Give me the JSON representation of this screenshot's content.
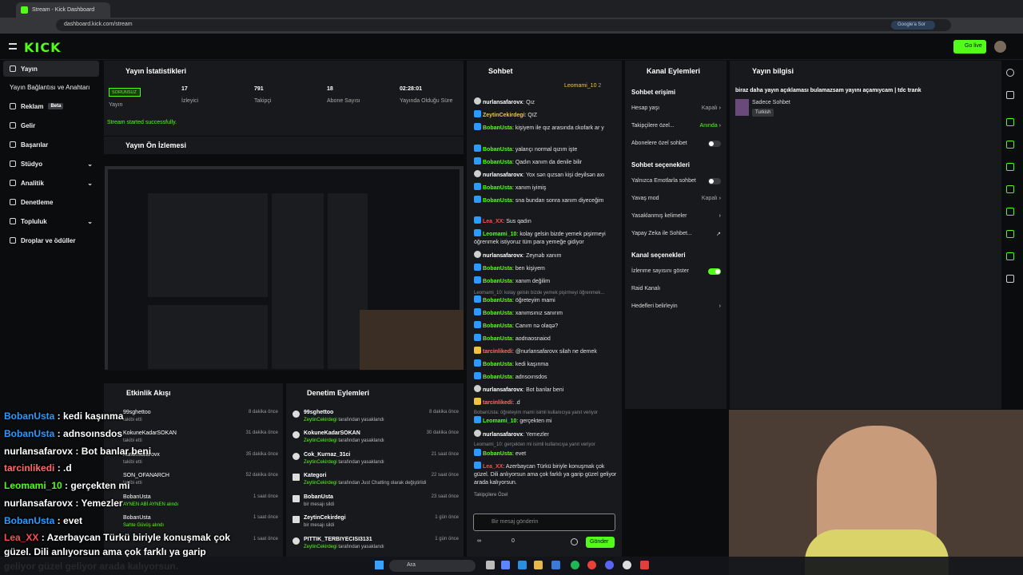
{
  "browser": {
    "tab_title": "Stream - Kick Dashboard",
    "url": "dashboard.kick.com/stream",
    "google_btn": "Google'a Sor"
  },
  "brand": {
    "logo": "KICK",
    "go_live": "Go live",
    "accent": "#53fc18"
  },
  "sidebar": {
    "items": [
      {
        "label": "Yayın"
      },
      {
        "label": "Yayın Bağlantısı ve Anahtarı"
      },
      {
        "label": "Reklam",
        "badge": "Beta"
      },
      {
        "label": "Gelir"
      },
      {
        "label": "Başarılar"
      },
      {
        "label": "Stüdyo"
      },
      {
        "label": "Analitik"
      },
      {
        "label": "Denetleme"
      },
      {
        "label": "Topluluk"
      },
      {
        "label": "Droplar ve ödüller"
      }
    ]
  },
  "stats": {
    "title": "Yayın İstatistikleri",
    "status": "SORUNSUZ",
    "status_label": "Yayın",
    "items": [
      {
        "value": "17",
        "label": "İzleyici"
      },
      {
        "value": "791",
        "label": "Takipçi"
      },
      {
        "value": "18",
        "label": "Abone Sayısı"
      },
      {
        "value": "02:28:01",
        "label": "Yayında Olduğu Süre"
      }
    ],
    "success": "Stream started successfully."
  },
  "preview": {
    "title": "Yayın Ön İzlemesi"
  },
  "activity": {
    "title": "Etkinlik Akışı",
    "items": [
      {
        "name": "99sghettoo",
        "sub": "takibi etti",
        "time": "8 dakika önce"
      },
      {
        "name": "KokuneKadarSOKAN",
        "sub": "takibi etti",
        "time": "31 dakika önce"
      },
      {
        "name": "nurlansafarovx",
        "sub": "takibi etti",
        "time": "35 dakika önce"
      },
      {
        "name": "SON_OFANARCH",
        "sub": "takibi etti",
        "time": "52 dakika önce"
      },
      {
        "name": "BobanUsta",
        "sub": "AYNEN ABİ AYNEN alındı",
        "time": "1 saat önce"
      },
      {
        "name": "BobanUsta",
        "sub": "Sahte Güvüş alındı",
        "time": "1 saat önce"
      },
      {
        "name": "",
        "sub": "",
        "time": "1 saat önce"
      }
    ]
  },
  "modlog": {
    "title": "Denetim Eylemleri",
    "items": [
      {
        "name": "99sghettoo",
        "by": "ZeytinCekirdegi",
        "sub": " tarafından yasaklandı",
        "time": "8 dakika önce"
      },
      {
        "name": "KokuneKadarSOKAN",
        "by": "ZeytinCekirdegi",
        "sub": " tarafından yasaklandı",
        "time": "30 dakika önce"
      },
      {
        "name": "Cok_Kurnaz_31ci",
        "by": "ZeytinCekirdegi",
        "sub": " tarafından yasaklandı",
        "time": "21 saat önce"
      },
      {
        "name": "Kategori",
        "by": "ZeytinCekirdegi",
        "sub": " tarafından Just Chatting olarak değiştirildi",
        "time": "22 saat önce"
      },
      {
        "name": "BobanUsta",
        "by": "",
        "sub": "bir mesajı sildi",
        "time": "23 saat önce"
      },
      {
        "name": "ZeytinCekirdegi",
        "by": "",
        "sub": "bir mesajı sildi",
        "time": "1 gün önce"
      },
      {
        "name": "PITTIK_TERBIYECISI3131",
        "by": "ZeytinCekirdegi",
        "sub": " tarafından yasaklandı",
        "time": "1 gün önce"
      }
    ]
  },
  "chat": {
    "title": "Sohbet",
    "pinned_user": "Leomami_10",
    "pinned_count": "2",
    "placeholder": "Bir mesaj gönderin",
    "send": "Gönder",
    "followers_only": "Takipçilere Özel",
    "viewers": "∞",
    "points": "0",
    "messages": [
      {
        "user": "nurlansafarovx",
        "color": "#ffffff",
        "text": "Qız"
      },
      {
        "user": "ZeytinCekirdegi",
        "color": "#f0c43c",
        "text": "QIZ"
      },
      {
        "user": "BobanUsta",
        "color": "#53fc18",
        "text": "kişiyem ile qız arasında ckofark ar y"
      },
      {
        "user": "BobanUsta",
        "color": "#53fc18",
        "text": "yalançı normal qızım işte"
      },
      {
        "user": "BobanUsta",
        "color": "#53fc18",
        "text": "Qadın xanım da denile bilir"
      },
      {
        "user": "nurlansafarovx",
        "color": "#ffffff",
        "text": "Yox sən qızsan kişi deyilsən axı"
      },
      {
        "user": "BobanUsta",
        "color": "#53fc18",
        "text": "xanım iyimiş"
      },
      {
        "user": "BobanUsta",
        "color": "#53fc18",
        "text": "sna bundan sonra xanım diyeceğim"
      },
      {
        "user": "Lea_XX",
        "color": "#ff4d4d",
        "text": "Sus qadın"
      },
      {
        "user": "Leomami_10",
        "color": "#53fc18",
        "text": "kolay gelsin bizde yemek pişirmeyi öğrenmek istiyoruz tüm para yemeğe gidiyor"
      },
      {
        "user": "nurlansafarovx",
        "color": "#ffffff",
        "text": "Zeynəb xanım"
      },
      {
        "user": "BobanUsta",
        "color": "#53fc18",
        "text": "ben kişiyem"
      },
      {
        "user": "BobanUsta",
        "color": "#53fc18",
        "text": "xanım değilim"
      },
      {
        "user": "BobanUsta",
        "color": "#53fc18",
        "text": "öğreteyim mami"
      },
      {
        "user": "BobanUsta",
        "color": "#53fc18",
        "text": "xanımsınız sanırım"
      },
      {
        "user": "BobanUsta",
        "color": "#53fc18",
        "text": "Canım nə olaqə?"
      },
      {
        "user": "BobanUsta",
        "color": "#53fc18",
        "text": "aodnaosnaiod"
      },
      {
        "user": "tarcinlikedi",
        "color": "#ff6b6b",
        "text": "@nurlansafarovx silah ne demek"
      },
      {
        "user": "BobanUsta",
        "color": "#53fc18",
        "text": "kedi kaşınma"
      },
      {
        "user": "BobanUsta",
        "color": "#53fc18",
        "text": "adnsoınsdos"
      },
      {
        "user": "nurlansafarovx",
        "color": "#ffffff",
        "text": "Bot banlar beni"
      },
      {
        "user": "tarcinlikedi",
        "color": "#ff6b6b",
        "text": ".d"
      },
      {
        "user": "Leomami_10",
        "color": "#53fc18",
        "text": "gerçekten mi"
      },
      {
        "user": "nurlansafarovx",
        "color": "#ffffff",
        "text": "Yemezler"
      },
      {
        "user": "BobanUsta",
        "color": "#53fc18",
        "text": "evet"
      },
      {
        "user": "Lea_XX",
        "color": "#ff4d4d",
        "text": "Azerbaycan Türkü biriyle konuşmak çok güzel. Dili anlıyorsun ama çok farklı ya garip güzel geliyor arada kalıyorsun."
      }
    ],
    "replies": [
      "Leomami_10: kolay gelsin bizde yemek pişirmeyi öğrenmek...",
      "BobanUsta: öğreteyim mami isimli kullanıcıya yanıt veriyor",
      "Leomami_10: gerçekten mi isimli kullanıcıya yanıt veriyor"
    ]
  },
  "channel": {
    "title": "Kanal Eylemleri",
    "sections": [
      {
        "head": "Sohbet erişimi",
        "rows": [
          {
            "label": "Hesap yaşı",
            "value": "Kapalı",
            "kind": "chev"
          },
          {
            "label": "Takipçilere özel...",
            "value": "Anında",
            "kind": "chev"
          },
          {
            "label": "Abonelere özel sohbet",
            "value": "",
            "kind": "off"
          }
        ]
      },
      {
        "head": "Sohbet seçenekleri",
        "rows": [
          {
            "label": "Yalnızca Emotlarla sohbet",
            "value": "",
            "kind": "off"
          },
          {
            "label": "Yavaş mod",
            "value": "Kapalı",
            "kind": "chev"
          },
          {
            "label": "Yasaklanmış kelimeler",
            "value": "",
            "kind": "chev"
          },
          {
            "label": "Yapay Zeka ile Sohbet...",
            "value": "",
            "kind": "ext"
          }
        ]
      },
      {
        "head": "Kanal seçenekleri",
        "rows": [
          {
            "label": "İzlenme sayısını göster",
            "value": "",
            "kind": "on"
          },
          {
            "label": "Raid Kanalı",
            "value": "",
            "kind": "none"
          },
          {
            "label": "Hedefleri belirleyin",
            "value": "",
            "kind": "chev"
          }
        ]
      }
    ]
  },
  "stream_info": {
    "title": "Yayın bilgisi",
    "stream_title": "biraz daha yayın açıklaması bulamazsam yayını açamıycam | tdc trank",
    "category": "Sadece Sohbet",
    "language": "Turkish"
  },
  "overlay": [
    {
      "user": "BobanUsta",
      "color": "#2b9bff",
      "text": "kedi kaşınma"
    },
    {
      "user": "BobanUsta",
      "color": "#2b9bff",
      "text": "adnsoınsdos"
    },
    {
      "user": "nurlansafarovx",
      "color": "#ffffff",
      "text": "Bot banlar beni"
    },
    {
      "user": "tarcinlikedi",
      "color": "#ff6b6b",
      "text": ".d"
    },
    {
      "user": "Leomami_10",
      "color": "#53fc18",
      "text": "gerçekten mi"
    },
    {
      "user": "nurlansafarovx",
      "color": "#ffffff",
      "text": "Yemezler"
    },
    {
      "user": "BobanUsta",
      "color": "#2b9bff",
      "text": "evet"
    },
    {
      "user": "Lea_XX",
      "color": "#ff4d4d",
      "text": "Azerbaycan Türkü biriyle konuşmak çok"
    },
    {
      "user": "",
      "color": "#ffffff",
      "text": "güzel. Dili anlıyorsun ama çok farklı ya garip"
    },
    {
      "user": "",
      "color": "#ffffff",
      "text": "geliyor güzel geliyor arada kalıyorsun."
    }
  ],
  "taskbar": {
    "search": "Ara"
  }
}
